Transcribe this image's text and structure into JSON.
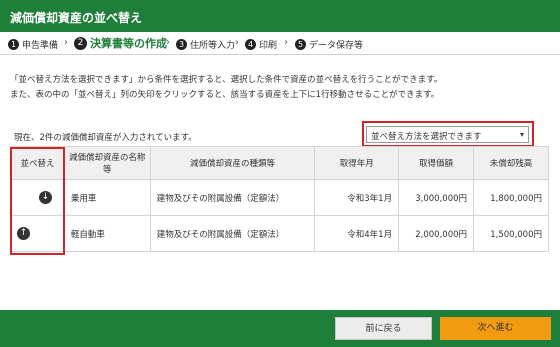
{
  "header": {
    "title": "減価償却資産の並べ替え"
  },
  "steps": [
    {
      "num": "1",
      "label": "申告準備"
    },
    {
      "num": "2",
      "label": "決算書等の作成"
    },
    {
      "num": "3",
      "label": "住所等入力"
    },
    {
      "num": "4",
      "label": "印刷"
    },
    {
      "num": "5",
      "label": "データ保存等"
    }
  ],
  "step_separator": "›",
  "description": {
    "line1": "「並べ替え方法を選択できます」から条件を選択すると、選択した条件で資産の並べ替えを行うことができます。",
    "line2": "また、表の中の「並べ替え」列の矢印をクリックすると、該当する資産を上下に1行移動させることができます。"
  },
  "count_text": "現在、2件の減価償却資産が入力されています。",
  "sort_select": {
    "value": "並べ替え方法を選択できます",
    "caret": "▾"
  },
  "table": {
    "headers": [
      "並べ替え",
      "減価償却資産の名称等",
      "減価償却資産の種類等",
      "取得年月",
      "取得価額",
      "未償却残高"
    ],
    "rows": [
      {
        "arrow": "↓",
        "name": "乗用車",
        "type": "建物及びその附属設備（定額法）",
        "acquired": "令和3年1月",
        "price": "3,000,000円",
        "balance": "1,800,000円"
      },
      {
        "arrow": "↑",
        "name": "軽自動車",
        "type": "建物及びその附属設備（定額法）",
        "acquired": "令和4年1月",
        "price": "2,000,000円",
        "balance": "1,500,000円"
      }
    ]
  },
  "footer": {
    "back_label": "前に戻る",
    "next_label": "次へ進む"
  },
  "colors": {
    "brand_green": "#1e7f3a",
    "highlight_red": "#d1232a",
    "next_orange": "#f29a10"
  }
}
